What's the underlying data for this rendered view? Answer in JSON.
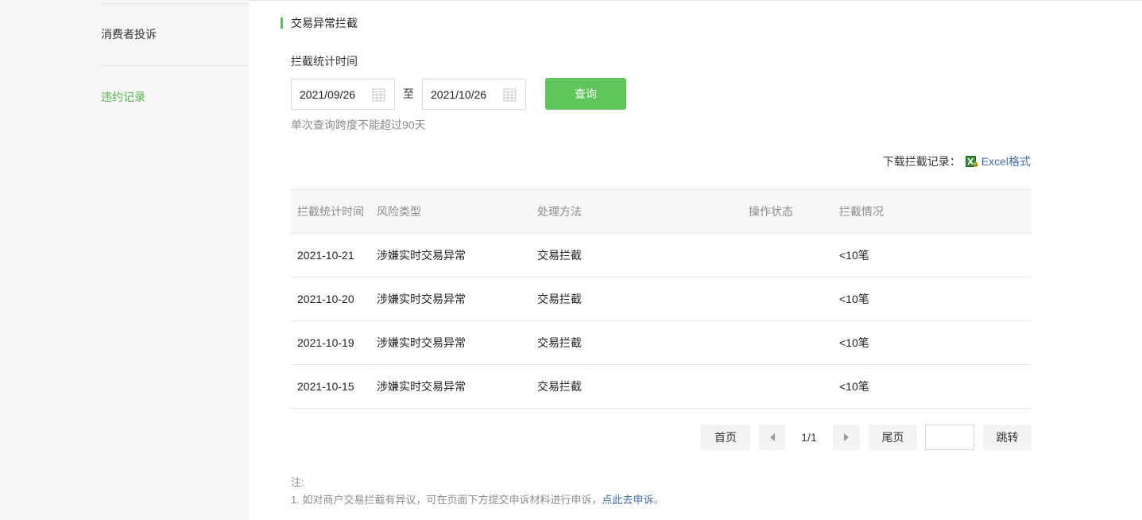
{
  "sidebar": {
    "items": [
      {
        "label": "消费者投诉"
      },
      {
        "label": "违约记录"
      }
    ]
  },
  "section": {
    "title": "交易异常拦截"
  },
  "filter": {
    "label": "拦截统计时间",
    "start_date": "2021/09/26",
    "end_date": "2021/10/26",
    "to_text": "至",
    "query_label": "查询",
    "hint": "单次查询跨度不能超过90天"
  },
  "download": {
    "label": "下载拦截记录：",
    "link_label": "Excel格式",
    "icon": "excel-icon"
  },
  "table": {
    "headers": [
      "拦截统计时间",
      "风险类型",
      "处理方法",
      "操作状态",
      "拦截情况"
    ],
    "rows": [
      {
        "date": "2021-10-21",
        "risk": "涉嫌实时交易异常",
        "method": "交易拦截",
        "status": "",
        "count": "<10笔"
      },
      {
        "date": "2021-10-20",
        "risk": "涉嫌实时交易异常",
        "method": "交易拦截",
        "status": "",
        "count": "<10笔"
      },
      {
        "date": "2021-10-19",
        "risk": "涉嫌实时交易异常",
        "method": "交易拦截",
        "status": "",
        "count": "<10笔"
      },
      {
        "date": "2021-10-15",
        "risk": "涉嫌实时交易异常",
        "method": "交易拦截",
        "status": "",
        "count": "<10笔"
      }
    ]
  },
  "pager": {
    "first": "首页",
    "info": "1/1",
    "last": "尾页",
    "jump_value": "",
    "go": "跳转"
  },
  "note": {
    "title": "注:",
    "line1_prefix": "1.  如对商户交易拦截有异议，可在页面下方提交申诉材料进行申诉，",
    "line1_link": "点此去申诉",
    "line1_suffix": "。"
  },
  "colors": {
    "accent_green": "#5fc45a",
    "active_nav": "#4fb944",
    "link_blue": "#3a6bb5"
  }
}
